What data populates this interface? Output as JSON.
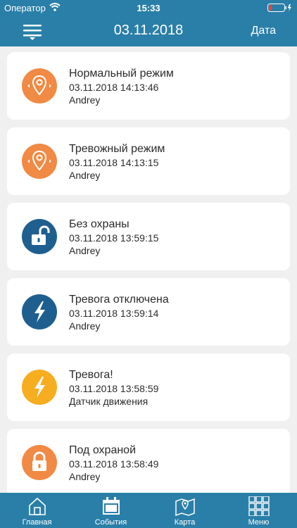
{
  "status_bar": {
    "carrier": "Оператор",
    "time": "15:33"
  },
  "nav": {
    "title": "03.11.2018",
    "date_button": "Дата"
  },
  "colors": {
    "header_blue": "#2a7fa8",
    "icon_orange": "#f08a45",
    "icon_blue": "#1f5f8f",
    "icon_yellow": "#f6ad1f"
  },
  "events": [
    {
      "title": "Нормальный режим",
      "time": "03.11.2018 14:13:46",
      "user": "Andrey",
      "icon": "location-pin-icon",
      "color": "#f08a45"
    },
    {
      "title": "Тревожный режим",
      "time": "03.11.2018 14:13:15",
      "user": "Andrey",
      "icon": "location-pin-icon",
      "color": "#f08a45"
    },
    {
      "title": "Без охраны",
      "time": "03.11.2018 13:59:15",
      "user": "Andrey",
      "icon": "unlocked-padlock-icon",
      "color": "#1f5f8f"
    },
    {
      "title": "Тревога отключена",
      "time": "03.11.2018 13:59:14",
      "user": "Andrey",
      "icon": "lightning-icon",
      "color": "#1f5f8f"
    },
    {
      "title": "Тревога!",
      "time": "03.11.2018 13:58:59",
      "user": "Датчик движения",
      "icon": "lightning-icon",
      "color": "#f6ad1f"
    },
    {
      "title": "Под охраной",
      "time": "03.11.2018 13:58:49",
      "user": "Andrey",
      "icon": "locked-padlock-icon",
      "color": "#f08a45"
    }
  ],
  "tabs": [
    {
      "label": "Главная",
      "icon": "home-icon"
    },
    {
      "label": "События",
      "icon": "calendar-icon"
    },
    {
      "label": "Карта",
      "icon": "map-icon"
    },
    {
      "label": "Меню",
      "icon": "grid-menu-icon"
    }
  ]
}
